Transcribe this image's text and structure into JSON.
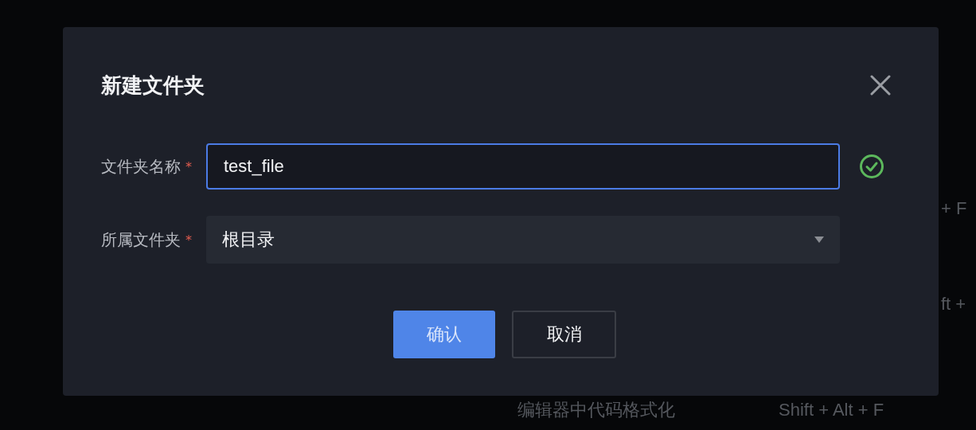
{
  "background_rows": [
    {
      "shortcut": "+ F"
    },
    {
      "shortcut": "ft +"
    },
    {
      "name": "编辑器中代码格式化",
      "shortcut": "Shift + Alt + F"
    }
  ],
  "dialog": {
    "title": "新建文件夹",
    "fields": [
      {
        "kind": "input",
        "label": "文件夹名称",
        "required_mark": "*",
        "value": "test_file",
        "focused": true,
        "valid": true
      },
      {
        "kind": "select",
        "label": "所属文件夹",
        "required_mark": "*",
        "value": "根目录",
        "focused": false,
        "valid": false
      }
    ],
    "buttons": [
      {
        "kind": "primary",
        "label": "确认"
      },
      {
        "kind": "secondary",
        "label": "取消"
      }
    ]
  }
}
